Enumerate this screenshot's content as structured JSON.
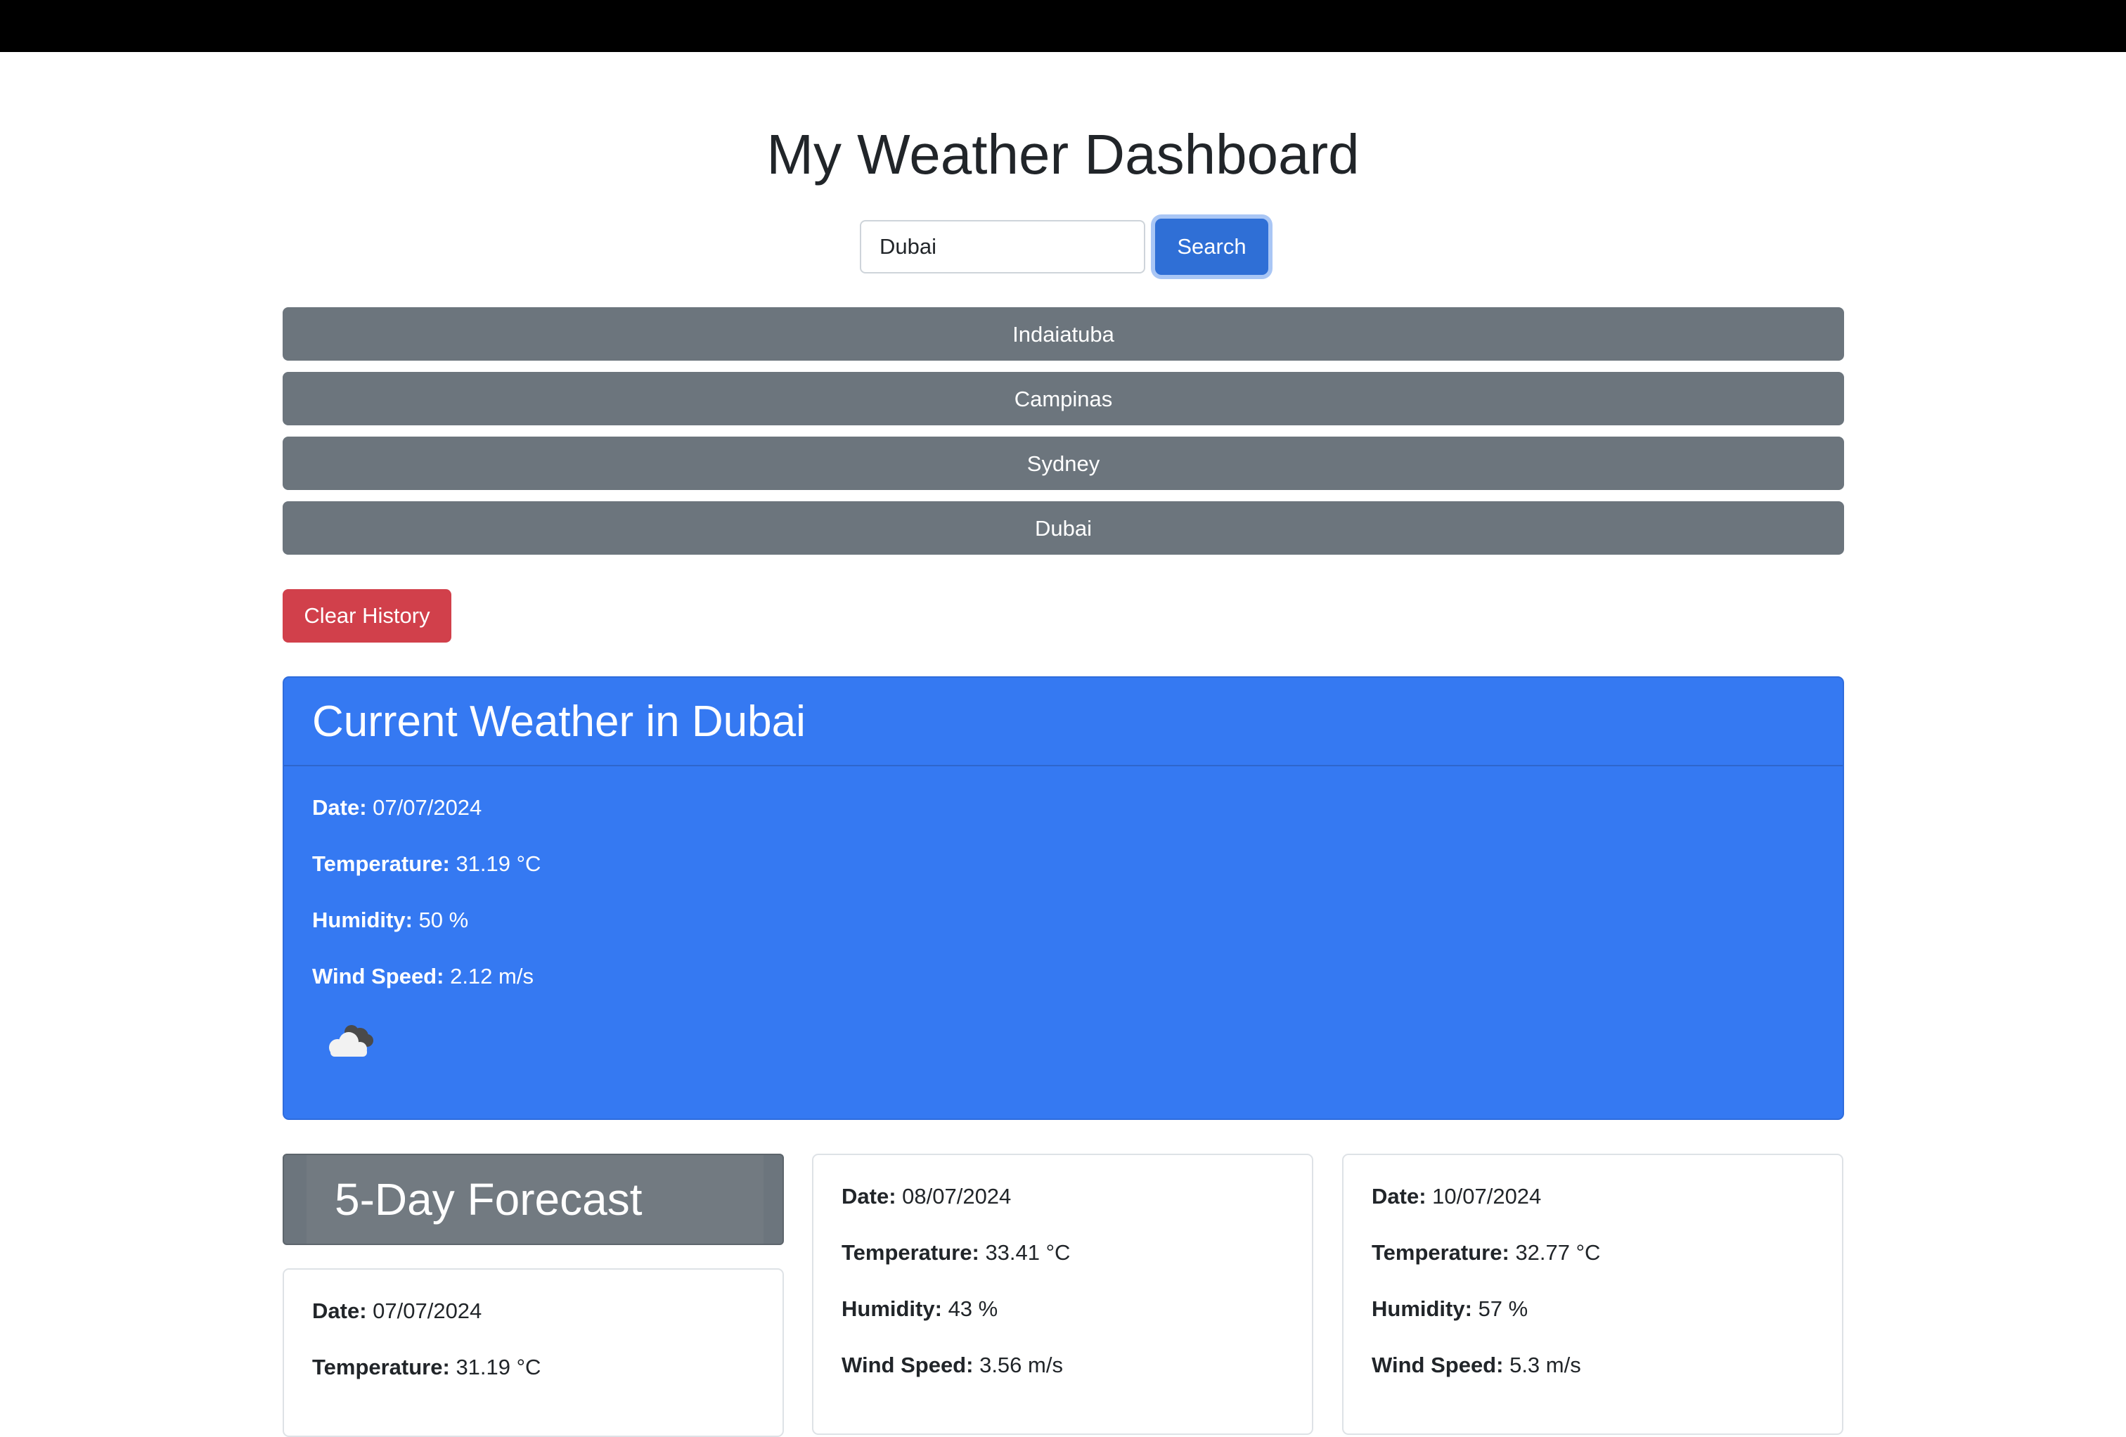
{
  "header": {
    "title": "My Weather Dashboard"
  },
  "search": {
    "value": "Dubai",
    "button_label": "Search"
  },
  "history": {
    "items": [
      {
        "label": "Indaiatuba"
      },
      {
        "label": "Campinas"
      },
      {
        "label": "Sydney"
      },
      {
        "label": "Dubai"
      }
    ],
    "clear_label": "Clear History"
  },
  "current": {
    "title": "Current Weather in Dubai",
    "labels": {
      "date": "Date:",
      "temperature": "Temperature:",
      "humidity": "Humidity:",
      "wind": "Wind Speed:"
    },
    "date": "07/07/2024",
    "temperature": "31.19 °C",
    "humidity": "50 %",
    "wind": "2.12 m/s",
    "icon": "cloud-icon",
    "colors": {
      "card": "#3579f2",
      "text": "#ffffff"
    }
  },
  "forecast": {
    "title": "5-Day Forecast",
    "labels": {
      "date": "Date:",
      "temperature": "Temperature:",
      "humidity": "Humidity:",
      "wind": "Wind Speed:"
    },
    "days": [
      {
        "date": "07/07/2024",
        "temperature": "31.19 °C"
      },
      {
        "date": "08/07/2024",
        "temperature": "33.41 °C",
        "humidity": "43 %",
        "wind": "3.56 m/s"
      },
      {
        "date": "10/07/2024",
        "temperature": "32.77 °C",
        "humidity": "57 %",
        "wind": "5.3 m/s"
      }
    ]
  },
  "colors": {
    "primary": "#2f6fd6",
    "secondary": "#6c757d",
    "danger": "#d1404b"
  }
}
